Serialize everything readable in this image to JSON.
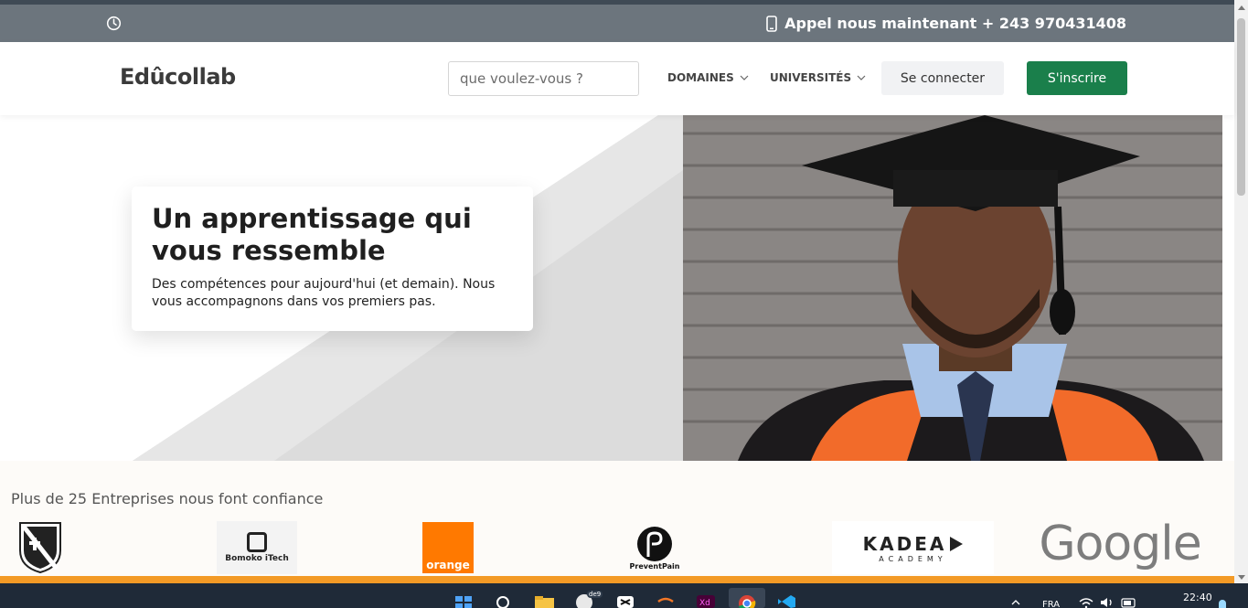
{
  "topbar": {
    "phone_text": "Appel nous maintenant + 243 970431408"
  },
  "nav": {
    "brand": "Edûcollab",
    "search_placeholder": "que voulez-vous ?",
    "domains_label": "DOMAINES",
    "universities_label": "UNIVERSITÉS",
    "login_label": "Se connecter",
    "signup_label": "S'inscrire"
  },
  "hero": {
    "title": "Un apprentissage qui vous ressemble",
    "subtitle": "Des compétences pour aujourd'hui (et demain). Nous vous accompagnons dans vos premiers pas."
  },
  "partners": {
    "title": "Plus de 25 Entreprises nous font confiance",
    "logos": [
      {
        "name": "university-crest",
        "text": ""
      },
      {
        "name": "bomoko-itech",
        "text": "Bomoko iTech"
      },
      {
        "name": "orange",
        "text": "orange"
      },
      {
        "name": "preventpain",
        "text": "PreventPain"
      },
      {
        "name": "kadea-academy",
        "text": "KADEA",
        "sub": "ACADEMY"
      },
      {
        "name": "google",
        "text": "Google"
      }
    ]
  },
  "taskbar": {
    "notification_badge": "de9",
    "language": "FRA",
    "time": "22:40"
  },
  "colors": {
    "topbar": "#6c757d",
    "signup": "#1a7f4b",
    "accent_bar": "#f39a26",
    "taskbar": "#1f2a38"
  }
}
